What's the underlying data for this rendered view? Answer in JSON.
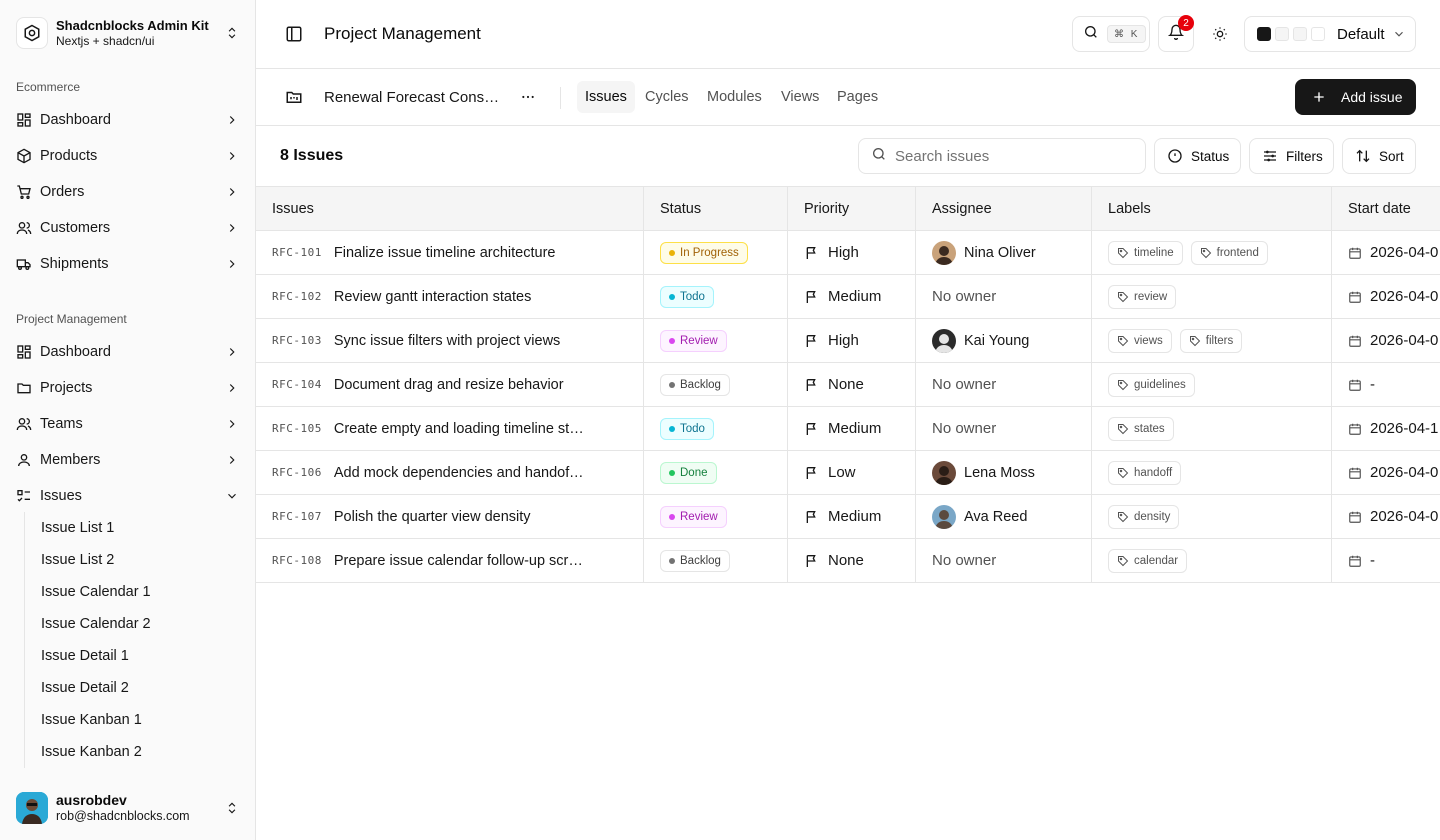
{
  "brand": {
    "name": "Shadcnblocks Admin Kit",
    "subtitle": "Nextjs + shadcn/ui"
  },
  "sidebar": {
    "groups": [
      {
        "label": "Ecommerce",
        "items": [
          "Dashboard",
          "Products",
          "Orders",
          "Customers",
          "Shipments"
        ]
      },
      {
        "label": "Project Management",
        "items": [
          "Dashboard",
          "Projects",
          "Teams",
          "Members",
          "Issues"
        ]
      }
    ],
    "issues_subitems": [
      "Issue List 1",
      "Issue List 2",
      "Issue Calendar 1",
      "Issue Calendar 2",
      "Issue Detail 1",
      "Issue Detail 2",
      "Issue Kanban 1",
      "Issue Kanban 2"
    ]
  },
  "user": {
    "name": "ausrobdev",
    "email": "rob@shadcnblocks.com"
  },
  "header": {
    "title": "Project Management",
    "search_shortcut": "⌘ K",
    "notifications": "2",
    "theme": "Default",
    "theme_swatches": [
      "#171717",
      "#f5f5f5",
      "#f5f5f5",
      "#ffffff"
    ]
  },
  "project": {
    "name": "Renewal Forecast Consolidation",
    "tabs": [
      "Issues",
      "Cycles",
      "Modules",
      "Views",
      "Pages"
    ],
    "active_tab": "Issues",
    "add_label": "Add issue"
  },
  "toolbar": {
    "count": "8 Issues",
    "search_placeholder": "Search issues",
    "status_label": "Status",
    "filters_label": "Filters",
    "sort_label": "Sort"
  },
  "table": {
    "headers": [
      "Issues",
      "Status",
      "Priority",
      "Assignee",
      "Labels",
      "Start date"
    ],
    "rows": [
      {
        "id": "RFC-101",
        "title": "Finalize issue timeline architecture",
        "status": "In Progress",
        "priority": "High",
        "assignee": "Nina Oliver",
        "labels": [
          "timeline",
          "frontend"
        ],
        "start": "2026-04-0"
      },
      {
        "id": "RFC-102",
        "title": "Review gantt interaction states",
        "status": "Todo",
        "priority": "Medium",
        "assignee": "No owner",
        "labels": [
          "review"
        ],
        "start": "2026-04-0"
      },
      {
        "id": "RFC-103",
        "title": "Sync issue filters with project views",
        "status": "Review",
        "priority": "High",
        "assignee": "Kai Young",
        "labels": [
          "views",
          "filters"
        ],
        "start": "2026-04-0"
      },
      {
        "id": "RFC-104",
        "title": "Document drag and resize behavior",
        "status": "Backlog",
        "priority": "None",
        "assignee": "No owner",
        "labels": [
          "guidelines"
        ],
        "start": "-"
      },
      {
        "id": "RFC-105",
        "title": "Create empty and loading timeline sta...",
        "status": "Todo",
        "priority": "Medium",
        "assignee": "No owner",
        "labels": [
          "states"
        ],
        "start": "2026-04-1"
      },
      {
        "id": "RFC-106",
        "title": "Add mock dependencies and handoff ...",
        "status": "Done",
        "priority": "Low",
        "assignee": "Lena Moss",
        "labels": [
          "handoff"
        ],
        "start": "2026-04-0"
      },
      {
        "id": "RFC-107",
        "title": "Polish the quarter view density",
        "status": "Review",
        "priority": "Medium",
        "assignee": "Ava Reed",
        "labels": [
          "density"
        ],
        "start": "2026-04-0"
      },
      {
        "id": "RFC-108",
        "title": "Prepare issue calendar follow-up scre...",
        "status": "Backlog",
        "priority": "None",
        "assignee": "No owner",
        "labels": [
          "calendar"
        ],
        "start": "-"
      }
    ]
  },
  "status_colors": {
    "In Progress": {
      "bg": "#fefce8",
      "border": "#fde047",
      "text": "#a16207",
      "dot": "#eab308"
    },
    "Todo": {
      "bg": "#ecfeff",
      "border": "#a5f3fc",
      "text": "#0e7490",
      "dot": "#06b6d4"
    },
    "Review": {
      "bg": "#fdf4ff",
      "border": "#f5d0fe",
      "text": "#a21caf",
      "dot": "#d946ef"
    },
    "Backlog": {
      "bg": "#ffffff",
      "border": "#e5e5e5",
      "text": "#404040",
      "dot": "#737373"
    },
    "Done": {
      "bg": "#f0fdf4",
      "border": "#bbf7d0",
      "text": "#15803d",
      "dot": "#22c55e"
    }
  }
}
